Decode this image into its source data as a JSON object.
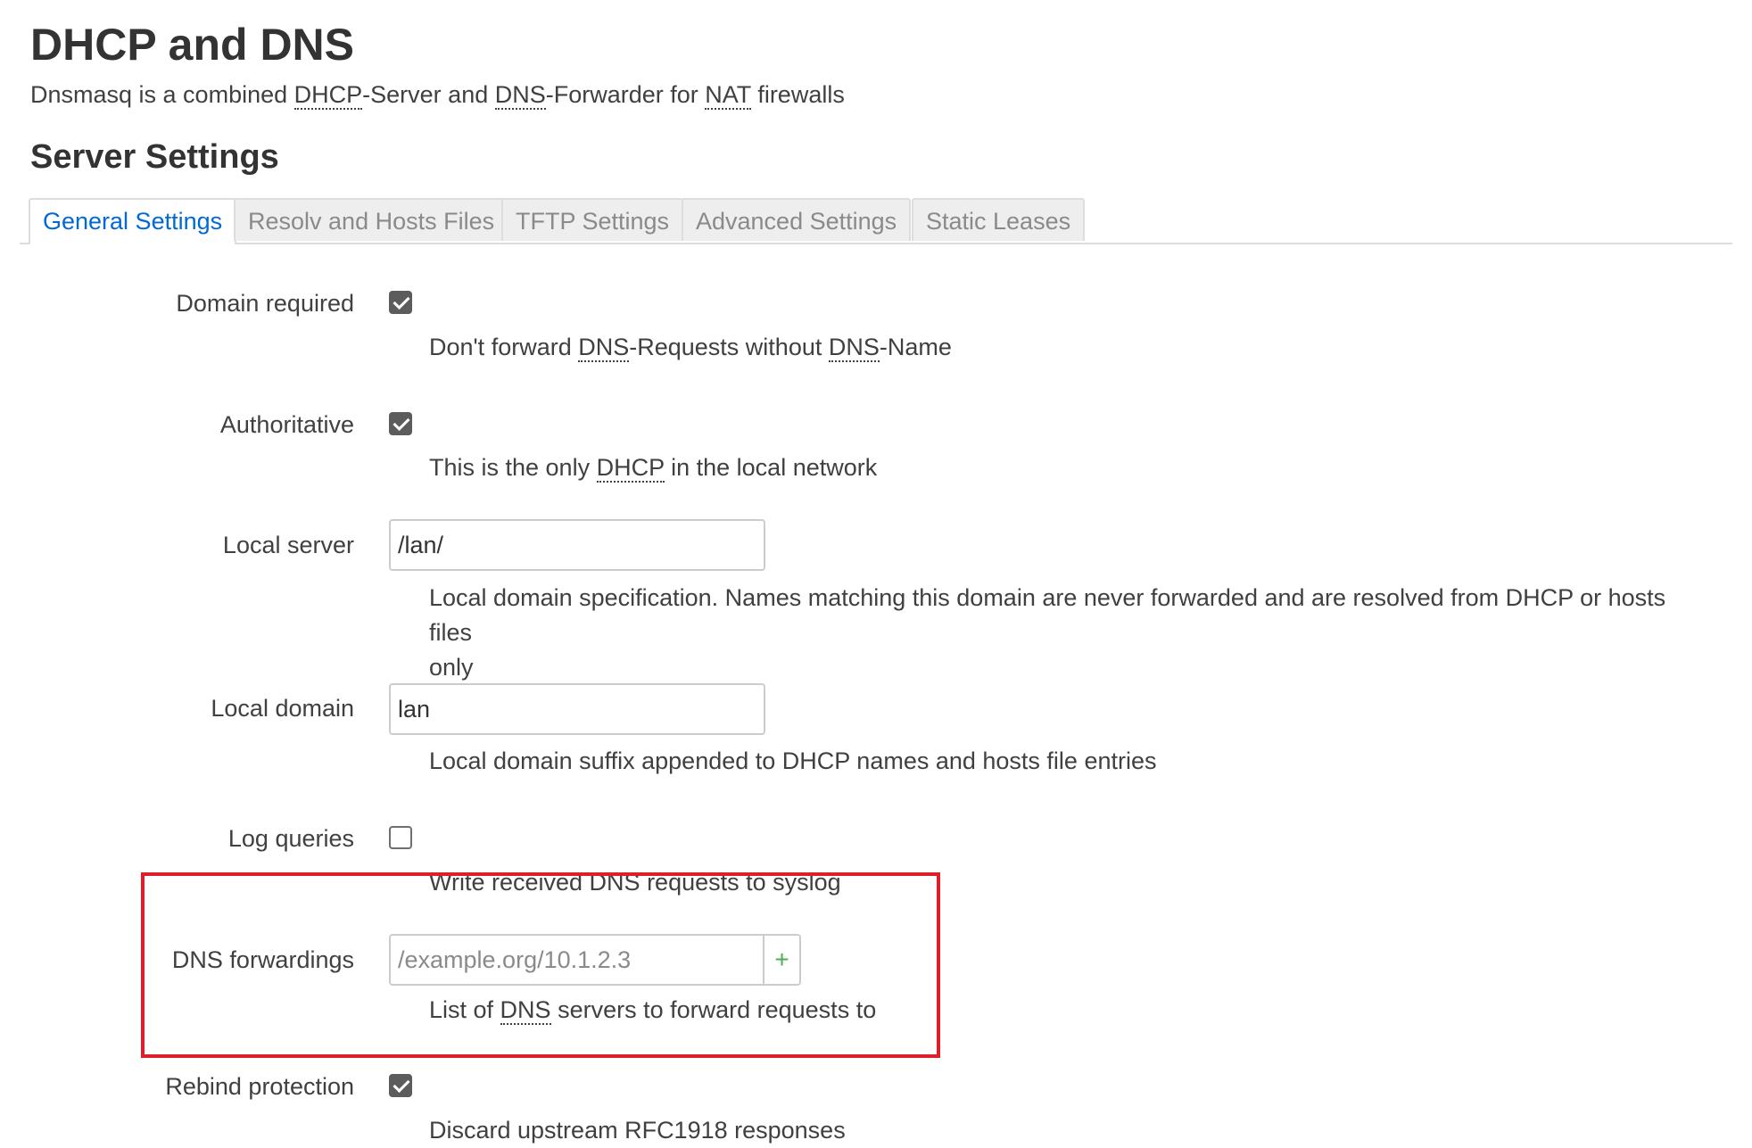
{
  "page": {
    "title": "DHCP and DNS",
    "desc_parts": [
      "Dnsmasq is a combined ",
      "DHCP",
      "-Server and ",
      "DNS",
      "-Forwarder for ",
      "NAT",
      " firewalls"
    ]
  },
  "section": {
    "title": "Server Settings",
    "tabs": [
      "General Settings",
      "Resolv and Hosts Files",
      "TFTP Settings",
      "Advanced Settings",
      "Static Leases"
    ],
    "active_tab": "General Settings"
  },
  "fields": {
    "domain_required": {
      "label": "Domain required",
      "checked": true,
      "help_parts": [
        "Don't forward ",
        "DNS",
        "-Requests without ",
        "DNS",
        "-Name"
      ]
    },
    "authoritative": {
      "label": "Authoritative",
      "checked": true,
      "help_parts": [
        "This is the only ",
        "DHCP",
        " in the local network"
      ]
    },
    "local_server": {
      "label": "Local server",
      "value": "/lan/",
      "help_line1": "Local domain specification. Names matching this domain are never forwarded and are resolved from DHCP or hosts files",
      "help_line2": "only"
    },
    "local_domain": {
      "label": "Local domain",
      "value": "lan",
      "help": "Local domain suffix appended to DHCP names and hosts file entries"
    },
    "log_queries": {
      "label": "Log queries",
      "checked": false,
      "help": "Write received DNS requests to syslog"
    },
    "dns_forwardings": {
      "label": "DNS forwardings",
      "placeholder": "/example.org/10.1.2.3",
      "add_symbol": "+",
      "help_parts": [
        "List of ",
        "DNS",
        " servers to forward requests to"
      ]
    },
    "rebind_protection": {
      "label": "Rebind protection",
      "checked": true,
      "help": "Discard upstream RFC1918 responses"
    }
  },
  "colors": {
    "active_tab": "#0069d6",
    "highlight_box": "#dc1f2b",
    "add_button": "#4caf50"
  }
}
